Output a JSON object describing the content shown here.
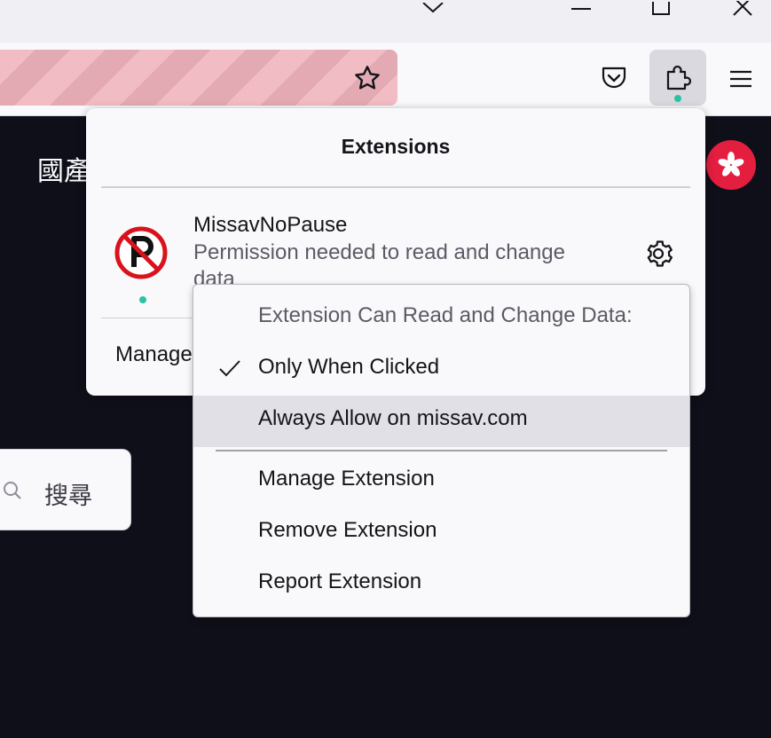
{
  "toolbar": {
    "bookmark_icon": "star-icon",
    "pocket_icon": "pocket-icon",
    "extensions_icon": "puzzle-icon",
    "menu_icon": "hamburger-icon"
  },
  "page": {
    "heading_partial": "國產",
    "search_placeholder": "搜尋"
  },
  "extensions_panel": {
    "title": "Extensions",
    "extension": {
      "name": "MissavNoPause",
      "message": "Permission needed to read and change data",
      "icon": "no-parking-icon"
    },
    "manage_label": "Manage"
  },
  "context_menu": {
    "header": "Extension Can Read and Change Data:",
    "items": [
      {
        "label": "Only When Clicked",
        "checked": true
      },
      {
        "label": "Always Allow on missav.com",
        "checked": false
      },
      {
        "label": "Manage Extension"
      },
      {
        "label": "Remove Extension"
      },
      {
        "label": "Report Extension"
      }
    ]
  },
  "colors": {
    "accent_dot": "#2ac3a2",
    "urlbar_stripe_a": "#f1bcc4",
    "urlbar_stripe_b": "#e4aab3",
    "badge_red": "#e41e3f",
    "page_bg": "#0f0f1a"
  }
}
